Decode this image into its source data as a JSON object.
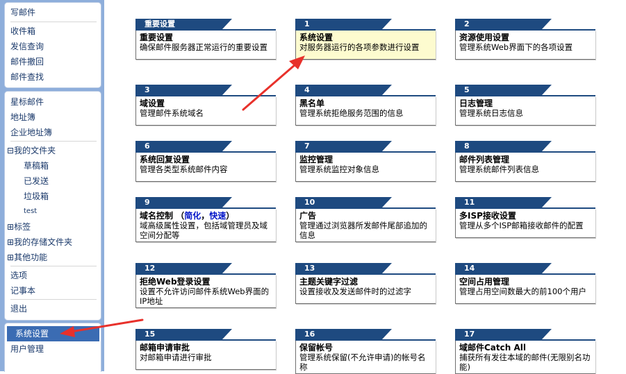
{
  "sidebar": {
    "group1": [
      "写邮件",
      "收件箱",
      "发信查询",
      "邮件撤回",
      "邮件查找"
    ],
    "group2": {
      "starred": "星标邮件",
      "address_book": "地址簿",
      "corp_address_book": "企业地址簿",
      "my_folders": "我的文件夹",
      "drafts": "草稿箱",
      "sent": "已发送",
      "trash": "垃圾箱",
      "test": "test",
      "tags": "标签",
      "storage_folders": "我的存储文件夹",
      "other_functions": "其他功能",
      "options": "选项",
      "notepad": "记事本",
      "logout": "退出"
    },
    "group3": {
      "system_settings": "系统设置",
      "user_management": "用户管理"
    },
    "toggle_symbol": "⊟",
    "expand_symbol": "⊞"
  },
  "cards": [
    {
      "tab": "重要设置",
      "title": "重要设置",
      "desc": "确保邮件服务器正常运行的重要设置"
    },
    {
      "tab": "1",
      "title": "系统设置",
      "desc": "对服务器运行的各项参数进行设置"
    },
    {
      "tab": "2",
      "title": "资源使用设置",
      "desc": "管理系统Web界面下的各项设置"
    },
    {
      "tab": "3",
      "title": "域设置",
      "desc": "管理邮件系统域名"
    },
    {
      "tab": "4",
      "title": "黑名单",
      "desc": "管理系统拒绝服务范围的信息"
    },
    {
      "tab": "5",
      "title": "日志管理",
      "desc": "管理系统日志信息"
    },
    {
      "tab": "6",
      "title": "系统回复设置",
      "desc": "管理各类型系统邮件内容"
    },
    {
      "tab": "7",
      "title": "监控管理",
      "desc": "管理系统监控对象信息"
    },
    {
      "tab": "8",
      "title": "邮件列表管理",
      "desc": "管理系统邮件列表信息"
    },
    {
      "tab": "9",
      "title": "域名控制",
      "link_open": "（",
      "link1": "简化",
      "link_sep": "，",
      "link2": "快速",
      "link_close": "）",
      "desc": "域高级属性设置，包括域管理员及域空间分配等"
    },
    {
      "tab": "10",
      "title": "广告",
      "desc": "管理通过浏览器所发邮件尾部追加的信息"
    },
    {
      "tab": "11",
      "title": "多ISP接收设置",
      "desc": "管理从多个ISP邮箱接收邮件的配置"
    },
    {
      "tab": "12",
      "title": "拒绝Web登录设置",
      "desc": "设置不允许访问邮件系统Web界面的IP地址"
    },
    {
      "tab": "13",
      "title": "主题关键字过滤",
      "desc": "设置接收及发送邮件时的过滤字"
    },
    {
      "tab": "14",
      "title": "空间占用管理",
      "desc": "管理占用空间数最大的前100个用户"
    },
    {
      "tab": "15",
      "title": "邮箱申请审批",
      "desc": "对邮箱申请进行审批"
    },
    {
      "tab": "16",
      "title": "保留帐号",
      "desc": "管理系统保留(不允许申请)的帐号名称"
    },
    {
      "tab": "17",
      "title": "域邮件Catch All",
      "desc": "捕获所有发往本域的邮件(无限别名功能)"
    }
  ],
  "colors": {
    "sidebar_bg": "#8eaedb",
    "tab_bg": "#1e4a80",
    "active_bg": "#3b6cb3",
    "highlight_card": "#fdfbcf",
    "annotation_arrow": "#e8312b"
  }
}
